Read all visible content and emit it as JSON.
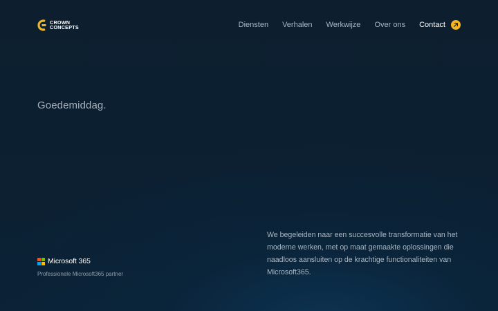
{
  "brand": {
    "line1": "CROWN",
    "line2": "CONCEPTS",
    "accent_color": "#f2b420"
  },
  "nav": {
    "items": [
      {
        "label": "Diensten"
      },
      {
        "label": "Verhalen"
      },
      {
        "label": "Werkwijze"
      },
      {
        "label": "Over ons"
      }
    ],
    "contact": {
      "label": "Contact",
      "icon": "arrow-up-right-icon"
    }
  },
  "hero": {
    "greeting": "Goedemiddag."
  },
  "partner": {
    "logo_name": "Microsoft 365",
    "caption": "Professionele Microsoft365 partner",
    "logo_colors": [
      "#f25022",
      "#7fba00",
      "#00a4ef",
      "#ffb900"
    ]
  },
  "description": {
    "text": "We begeleiden naar een succesvolle transformatie van het moderne werken, met op maat gemaakte oplossingen die naadloos aansluiten op de krachtige functionaliteiten van Microsoft365."
  }
}
